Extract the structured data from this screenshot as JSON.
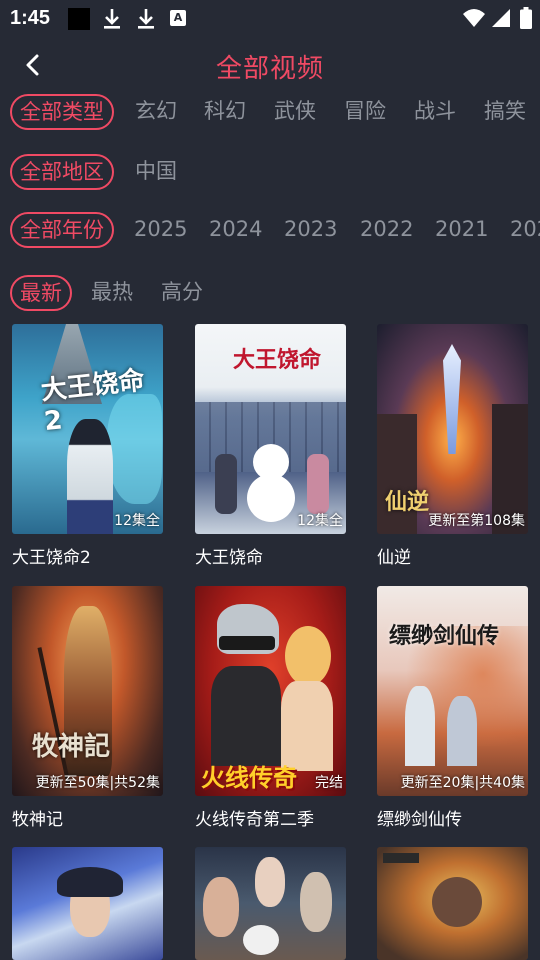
{
  "status": {
    "time": "1:45",
    "a_icon": "A"
  },
  "header": {
    "title": "全部视频"
  },
  "filters": {
    "type": [
      "全部类型",
      "玄幻",
      "科幻",
      "武侠",
      "冒险",
      "战斗",
      "搞笑"
    ],
    "region": [
      "全部地区",
      "中国"
    ],
    "year": [
      "全部年份",
      "2025",
      "2024",
      "2023",
      "2022",
      "2021",
      "202"
    ],
    "sort": [
      "最新",
      "最热",
      "高分"
    ]
  },
  "videos": [
    {
      "title": "大王饶命2",
      "badge": "12集全",
      "art_text": "大王饶命2"
    },
    {
      "title": "大王饶命",
      "badge": "12集全",
      "art_text": "大王饶命"
    },
    {
      "title": "仙逆",
      "badge": "更新至第108集",
      "art_text": "仙逆"
    },
    {
      "title": "牧神记",
      "badge": "更新至50集|共52集",
      "art_text": "牧神記"
    },
    {
      "title": "火线传奇第二季",
      "badge": "完结",
      "art_text": "火线传奇"
    },
    {
      "title": "缥缈剑仙传",
      "badge": "更新至20集|共40集",
      "art_text": "缥缈剑仙传"
    },
    {
      "title": "",
      "badge": "",
      "art_text": ""
    },
    {
      "title": "",
      "badge": "",
      "art_text": ""
    },
    {
      "title": "",
      "badge": "",
      "art_text": ""
    }
  ],
  "colors": {
    "accent": "#f04a64",
    "background": "#262a35"
  }
}
